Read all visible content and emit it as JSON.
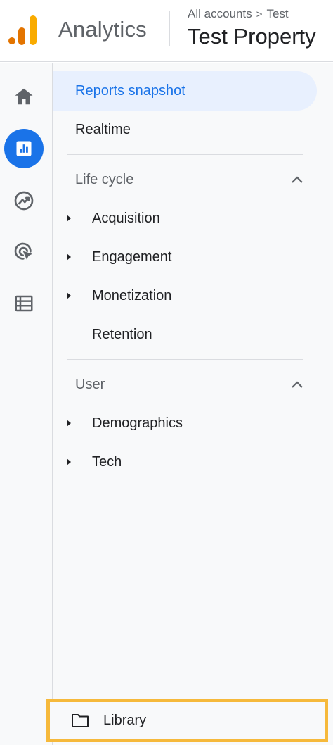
{
  "header": {
    "app_title": "Analytics",
    "breadcrumb": {
      "root": "All accounts",
      "separator": ">",
      "account": "Test"
    },
    "property": "Test Property"
  },
  "rail": {
    "items": [
      {
        "icon": "home-icon",
        "active": false
      },
      {
        "icon": "reports-icon",
        "active": true
      },
      {
        "icon": "explore-icon",
        "active": false
      },
      {
        "icon": "advertising-icon",
        "active": false
      },
      {
        "icon": "configure-icon",
        "active": false
      }
    ],
    "accent_color": "#1a73e8"
  },
  "nav": {
    "reports_snapshot": "Reports snapshot",
    "realtime": "Realtime",
    "lifecycle": {
      "title": "Life cycle",
      "items": [
        {
          "label": "Acquisition",
          "expandable": true
        },
        {
          "label": "Engagement",
          "expandable": true
        },
        {
          "label": "Monetization",
          "expandable": true
        },
        {
          "label": "Retention",
          "expandable": false
        }
      ]
    },
    "user": {
      "title": "User",
      "items": [
        {
          "label": "Demographics",
          "expandable": true
        },
        {
          "label": "Tech",
          "expandable": true
        }
      ]
    },
    "library": "Library"
  },
  "colors": {
    "highlight_border": "#f6b93b",
    "selected_bg": "#e8f0fe"
  }
}
